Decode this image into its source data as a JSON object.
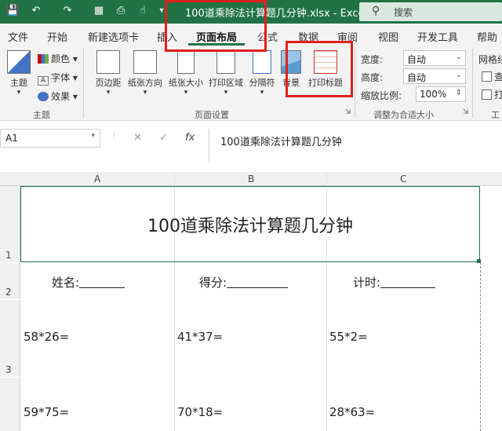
{
  "titlebar": {
    "doc_title": "100道乘除法计算题几分钟.xlsx - Excel",
    "search_placeholder": "搜索",
    "qat_icons": [
      "save-icon",
      "undo-icon",
      "redo-icon",
      "form-icon",
      "print-preview-icon",
      "touch-icon"
    ]
  },
  "tabs": [
    "文件",
    "开始",
    "新建选项卡",
    "插入",
    "页面布局",
    "公式",
    "数据",
    "审阅",
    "视图",
    "开发工具",
    "帮助"
  ],
  "active_tab": "页面布局",
  "ribbon": {
    "theme": {
      "main": "主题",
      "color": "颜色",
      "font": "字体",
      "effect": "效果",
      "group": "主题"
    },
    "page_setup": {
      "margins": "页边距",
      "orientation": "纸张方向",
      "size": "纸张大小",
      "print_area": "打印区域",
      "breaks": "分隔符",
      "background": "背景",
      "print_titles": "打印标题",
      "group": "页面设置"
    },
    "scale": {
      "width_label": "宽度:",
      "width_value": "自动",
      "height_label": "高度:",
      "height_value": "自动",
      "scale_label": "缩放比例:",
      "scale_value": "100%",
      "group": "调整为合适大小"
    },
    "sheet_options": {
      "gridlines": "网格线",
      "view_initial": "查",
      "print_initial": "打",
      "group_initial": "工"
    }
  },
  "formula_bar": {
    "name_box": "A1",
    "fx": "fx",
    "content": "100道乘除法计算题几分钟"
  },
  "sheet": {
    "columns": [
      "A",
      "B",
      "C"
    ],
    "rows": [
      "1",
      "2",
      "3"
    ],
    "title": "100道乘除法计算题几分钟",
    "row2": {
      "name_label": "姓名:",
      "score_label": "得分:",
      "time_label": "计时:"
    },
    "row3": [
      "58*26=",
      "41*37=",
      "55*2="
    ],
    "row4": [
      "59*75=",
      "70*18=",
      "28*63="
    ]
  },
  "colors": {
    "excel_green": "#217346",
    "highlight_red": "#e0201c"
  }
}
